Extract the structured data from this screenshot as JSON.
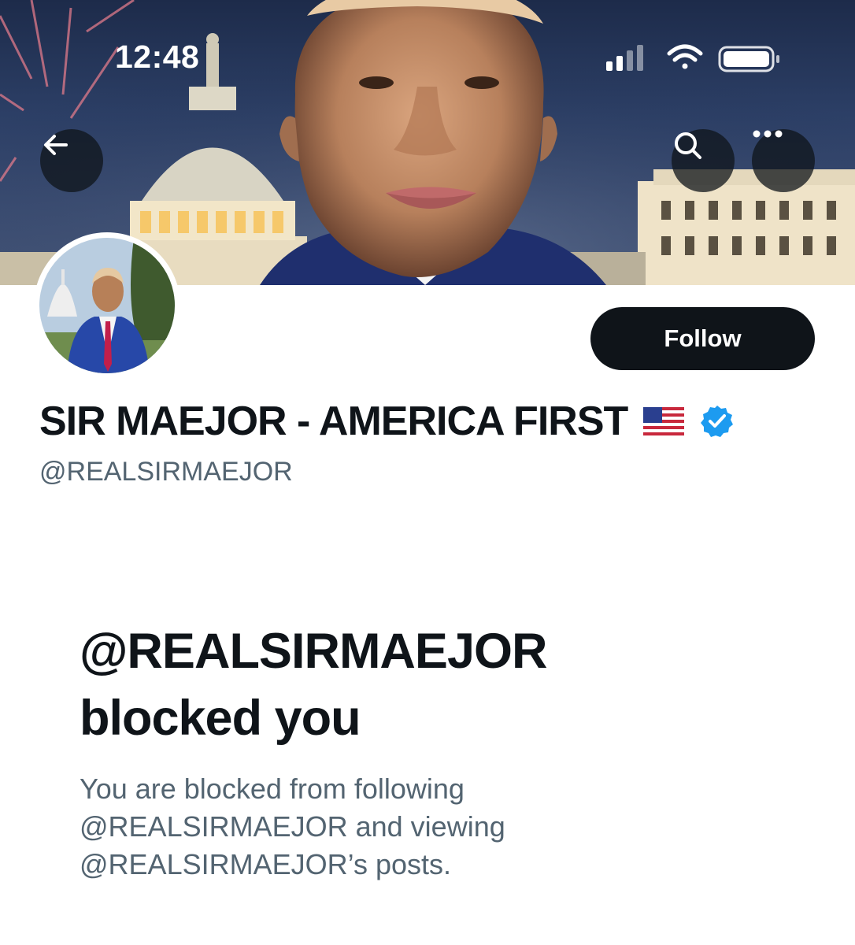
{
  "status_bar": {
    "time": "12:48",
    "signal_icon": "cellular-signal-icon",
    "wifi_icon": "wifi-icon",
    "battery_icon": "battery-icon"
  },
  "header": {
    "back_icon": "back-arrow-icon",
    "search_icon": "search-icon",
    "more_icon": "more-options-icon"
  },
  "profile": {
    "display_name": "SIR MAEJOR - AMERICA FIRST",
    "flag_icon": "us-flag-icon",
    "verified_icon": "verified-badge-icon",
    "verified_color": "#1d9bf0",
    "handle": "@REALSIRMAEJOR",
    "follow_label": "Follow"
  },
  "blocked": {
    "title_line1": "@REALSIRMAEJOR",
    "title_line2": "blocked you",
    "description": "You are blocked from following @REALSIRMAEJOR and viewing @REALSIRMAEJOR’s posts."
  },
  "colors": {
    "primary_text": "#0f1419",
    "secondary_text": "#536471",
    "button_bg": "#0f1419",
    "accent": "#1d9bf0"
  }
}
